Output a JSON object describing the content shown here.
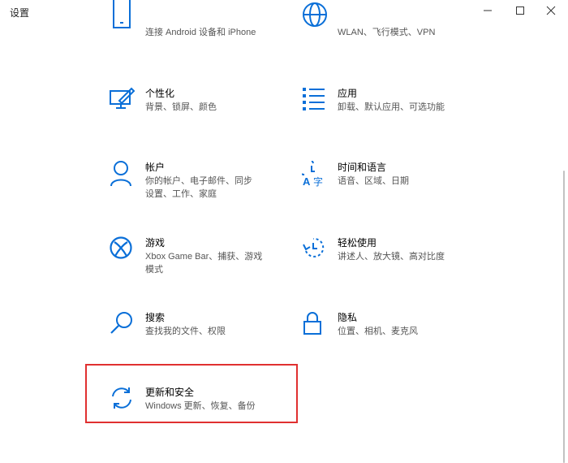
{
  "window": {
    "title": "设置",
    "controls": {
      "minimize": "minimize-icon",
      "maximize": "maximize-icon",
      "close": "close-icon"
    }
  },
  "accent_color": "#0a6fd8",
  "highlight_color": "#e03030",
  "tiles": [
    {
      "id": "phone",
      "title": "",
      "subtitle": "连接 Android 设备和 iPhone",
      "icon": "phone-icon"
    },
    {
      "id": "network",
      "title": "",
      "subtitle": "WLAN、飞行模式、VPN",
      "icon": "globe-icon"
    },
    {
      "id": "personalize",
      "title": "个性化",
      "subtitle": "背景、锁屏、颜色",
      "icon": "paint-monitor-icon"
    },
    {
      "id": "apps",
      "title": "应用",
      "subtitle": "卸载、默认应用、可选功能",
      "icon": "apps-list-icon"
    },
    {
      "id": "accounts",
      "title": "帐户",
      "subtitle": "你的帐户、电子邮件、同步设置、工作、家庭",
      "icon": "person-icon"
    },
    {
      "id": "time-language",
      "title": "时间和语言",
      "subtitle": "语音、区域、日期",
      "icon": "time-language-icon"
    },
    {
      "id": "gaming",
      "title": "游戏",
      "subtitle": "Xbox Game Bar、捕获、游戏模式",
      "icon": "xbox-icon"
    },
    {
      "id": "ease-access",
      "title": "轻松使用",
      "subtitle": "讲述人、放大镜、高对比度",
      "icon": "ease-of-access-icon"
    },
    {
      "id": "search",
      "title": "搜索",
      "subtitle": "查找我的文件、权限",
      "icon": "search-icon"
    },
    {
      "id": "privacy",
      "title": "隐私",
      "subtitle": "位置、相机、麦克风",
      "icon": "lock-icon"
    },
    {
      "id": "update",
      "title": "更新和安全",
      "subtitle": "Windows 更新、恢复、备份",
      "icon": "refresh-icon"
    }
  ]
}
